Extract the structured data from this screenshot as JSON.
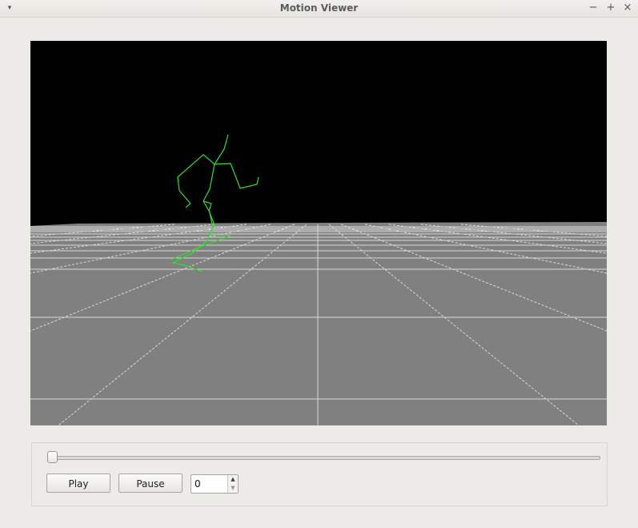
{
  "window": {
    "title": "Motion Viewer",
    "buttons": {
      "menu": "▾",
      "minimize": "−",
      "maximize": "+",
      "close": "×"
    }
  },
  "viewport": {
    "background_color": "#000000",
    "ground_color": "#808080",
    "grid_color": "#d8d8d8",
    "skeleton_color": "#33dd33"
  },
  "controls": {
    "slider_value": 0,
    "play_label": "Play",
    "pause_label": "Pause",
    "frame_value": "0",
    "spin_up": "▲",
    "spin_down": "▼"
  }
}
